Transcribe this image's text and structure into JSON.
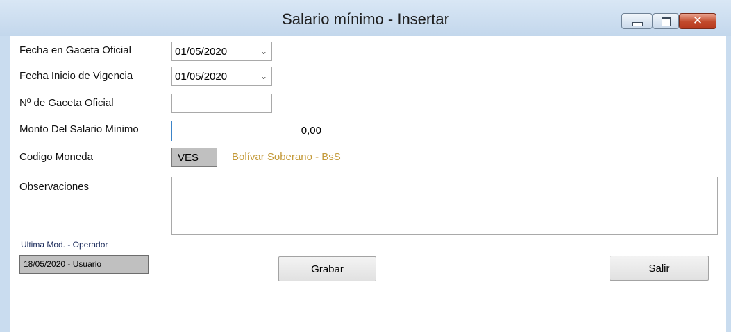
{
  "window": {
    "title": "Salario mínimo - Insertar",
    "controls": {
      "minimize_icon": "minimize-icon",
      "maximize_icon": "maximize-icon",
      "close_icon": "close-icon",
      "close_glyph": "✕"
    }
  },
  "form": {
    "fecha_gaceta": {
      "label": "Fecha en Gaceta Oficial",
      "value": "01/05/2020",
      "arrow": "⌄"
    },
    "fecha_inicio": {
      "label": "Fecha Inicio de Vigencia",
      "value": "01/05/2020",
      "arrow": "⌄"
    },
    "num_gaceta": {
      "label": "Nº de Gaceta Oficial",
      "value": ""
    },
    "monto": {
      "label": "Monto Del Salario Minimo",
      "value": "0,00"
    },
    "moneda": {
      "label": "Codigo Moneda",
      "code": "VES",
      "description": "Bolívar Soberano - BsS"
    },
    "observaciones": {
      "label": "Observaciones",
      "value": ""
    }
  },
  "footer": {
    "last_mod_label": "Ultima Mod. - Operador",
    "last_mod_value": "18/05/2020 - Usuario",
    "save_label": "Grabar",
    "exit_label": "Salir"
  },
  "colors": {
    "title_bar": "#c9dcef",
    "currency_text": "#c49a3a",
    "close_button": "#c24a2c"
  }
}
